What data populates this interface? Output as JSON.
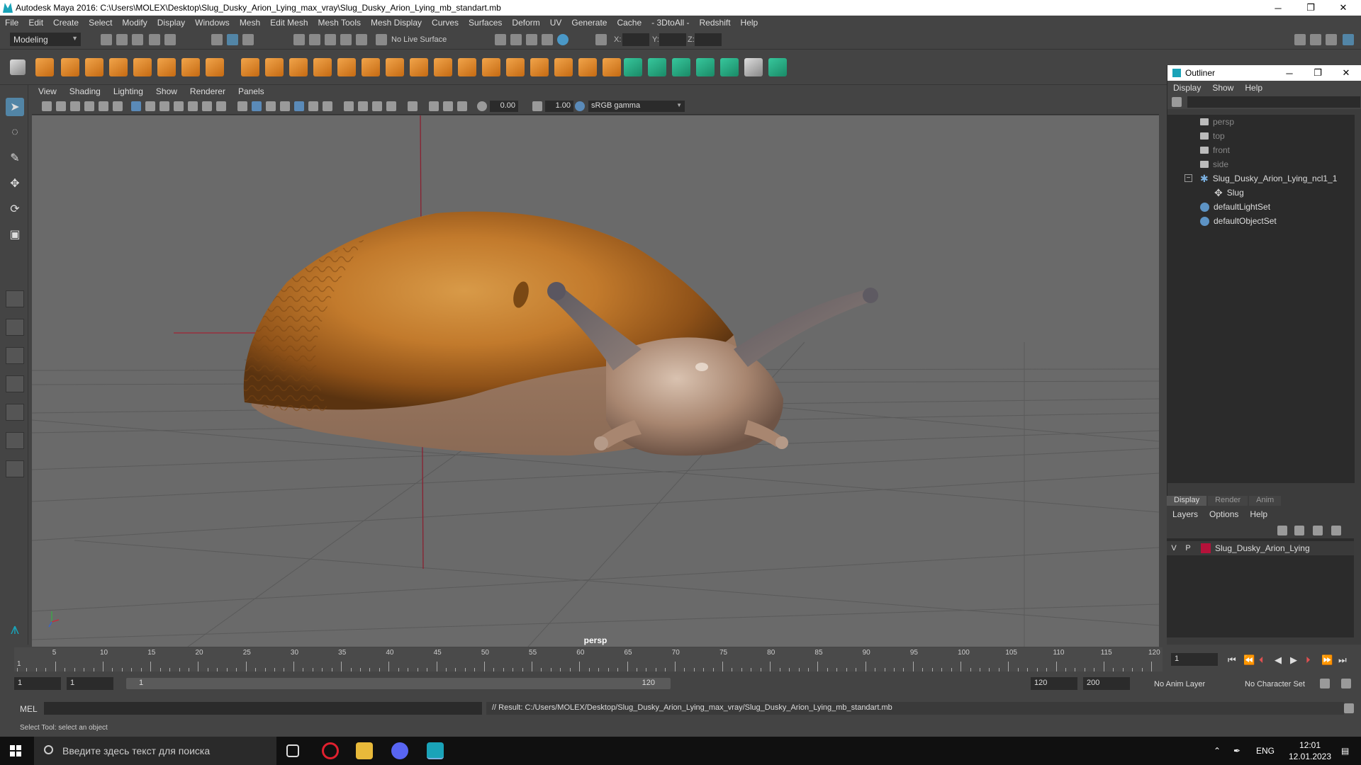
{
  "window": {
    "title": "Autodesk Maya 2016: C:\\Users\\MOLEX\\Desktop\\Slug_Dusky_Arion_Lying_max_vray\\Slug_Dusky_Arion_Lying_mb_standart.mb",
    "minimize": "─",
    "restore": "❐",
    "close": "✕"
  },
  "menubar": [
    "File",
    "Edit",
    "Create",
    "Select",
    "Modify",
    "Display",
    "Windows",
    "Mesh",
    "Edit Mesh",
    "Mesh Tools",
    "Mesh Display",
    "Curves",
    "Surfaces",
    "Deform",
    "UV",
    "Generate",
    "Cache",
    "- 3DtoAll -",
    "Redshift",
    "Help"
  ],
  "statusline": {
    "mode": "Modeling",
    "live_surface": "No Live Surface",
    "x_label": "X:",
    "y_label": "Y:",
    "z_label": "Z:"
  },
  "viewport": {
    "menu": [
      "View",
      "Shading",
      "Lighting",
      "Show",
      "Renderer",
      "Panels"
    ],
    "exposure": "0.00",
    "gamma_value": "1.00",
    "color_space": "sRGB gamma",
    "camera_label": "persp"
  },
  "outliner": {
    "title": "Outliner",
    "menu": [
      "Display",
      "Show",
      "Help"
    ],
    "items": [
      {
        "label": "persp",
        "type": "camera"
      },
      {
        "label": "top",
        "type": "camera"
      },
      {
        "label": "front",
        "type": "camera"
      },
      {
        "label": "side",
        "type": "camera"
      },
      {
        "label": "Slug_Dusky_Arion_Lying_ncl1_1",
        "type": "group"
      },
      {
        "label": "Slug",
        "type": "mesh"
      },
      {
        "label": "defaultLightSet",
        "type": "set"
      },
      {
        "label": "defaultObjectSet",
        "type": "set"
      }
    ],
    "collapse_symbol": "−"
  },
  "layer_editor": {
    "tabs": [
      "Display",
      "Render",
      "Anim"
    ],
    "menu": [
      "Layers",
      "Options",
      "Help"
    ],
    "layer": {
      "visible": "V",
      "playback": "P",
      "name": "Slug_Dusky_Arion_Lying",
      "color": "#b5123a"
    }
  },
  "timeline": {
    "ticks": [
      "5",
      "10",
      "15",
      "20",
      "25",
      "30",
      "35",
      "40",
      "45",
      "50",
      "55",
      "60",
      "65",
      "70",
      "75",
      "80",
      "85",
      "90",
      "95",
      "100",
      "105",
      "110",
      "115",
      "120"
    ],
    "start_marker": "1",
    "current_frame": "1"
  },
  "range": {
    "start": "1",
    "playback_start": "1",
    "bar_start": "1",
    "bar_end": "120",
    "playback_end": "120",
    "end": "200",
    "anim_layer": "No Anim Layer",
    "character_set": "No Character Set"
  },
  "cmdline": {
    "lang": "MEL",
    "result": "// Result: C:/Users/MOLEX/Desktop/Slug_Dusky_Arion_Lying_max_vray/Slug_Dusky_Arion_Lying_mb_standart.mb"
  },
  "helpline": "Select Tool: select an object",
  "taskbar": {
    "search_placeholder": "Введите здесь текст для поиска",
    "lang": "ENG",
    "time": "12:01",
    "date": "12.01.2023"
  }
}
